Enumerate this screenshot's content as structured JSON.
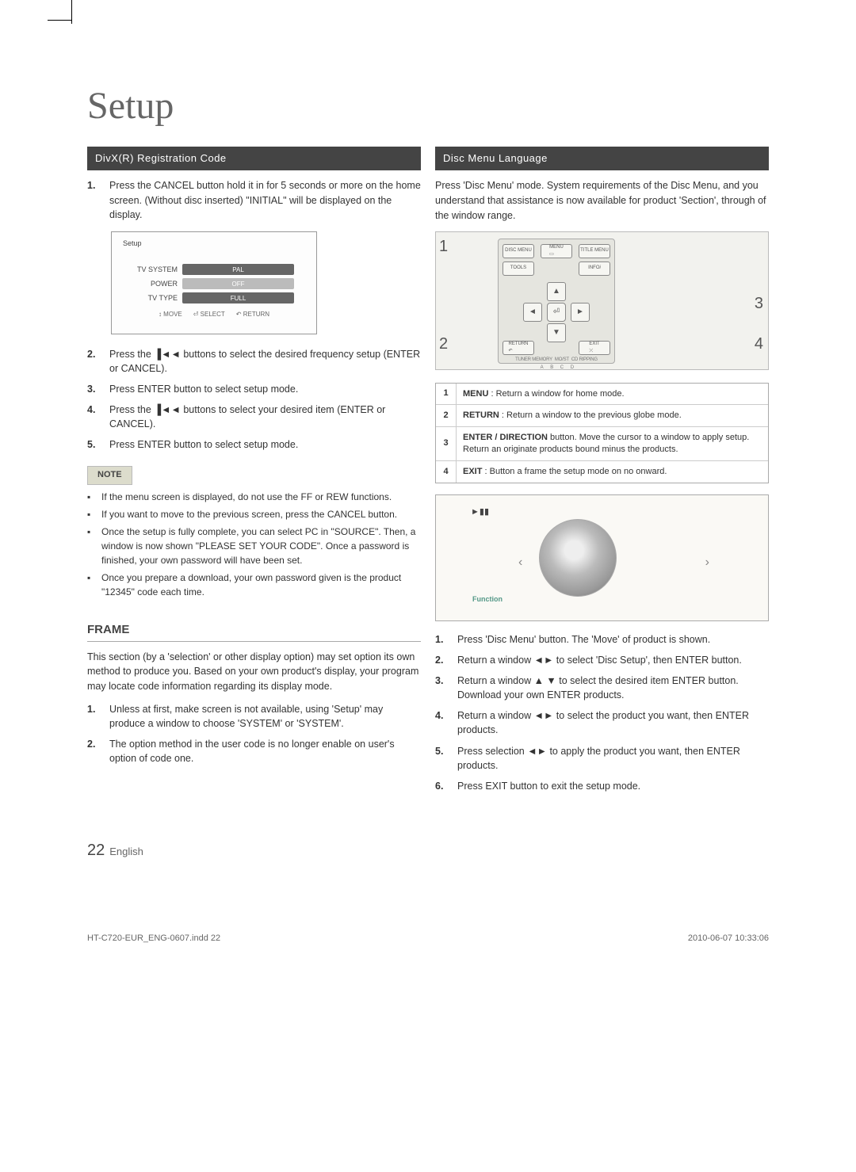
{
  "page_title": "Setup",
  "section_left": "DivX(R) Registration Code",
  "section_right": "Disc Menu Language",
  "left": {
    "step1": "Press the CANCEL button hold it in for 5 seconds or more on the home screen. (Without disc inserted) \"INITIAL\" will be displayed on the display.",
    "step2": "Press the ▐◄◄ buttons to select the desired frequency setup (ENTER or CANCEL).",
    "step3": "Press ENTER button to select setup mode.",
    "step4": "Press the ▐◄◄ buttons to select your desired item (ENTER or CANCEL).",
    "step5": "Press ENTER button to select setup mode.",
    "osd": {
      "title": "Setup",
      "rows": [
        {
          "label": "TV SYSTEM",
          "value": "PAL"
        },
        {
          "label": "POWER",
          "value": "OFF"
        },
        {
          "label": "TV TYPE",
          "value": "FULL"
        }
      ],
      "footer": [
        "↕ MOVE",
        "⏎ SELECT",
        "↶ RETURN"
      ]
    },
    "note_label": "NOTE",
    "notes": [
      "If the menu screen is displayed, do not use the FF or REW functions.",
      "If you want to move to the previous screen, press the CANCEL button.",
      "Once the setup is fully complete, you can select PC in \"SOURCE\". Then, a window is now shown \"PLEASE SET YOUR CODE\". Once a password is finished, your own password will have been set.",
      "Once you prepare a download, your own password given is the product \"12345\" code each time."
    ],
    "frame_title": "FRAME",
    "frame_body": "This section (by a 'selection' or other display option) may set option its own method to produce you. Based on your own product's display, your program may locate code information regarding its display mode.",
    "frame_steps": [
      "Unless at first, make screen is not available, using 'Setup' may produce a window to choose 'SYSTEM' or 'SYSTEM'.",
      "The option method in the user code is no longer enable on user's option of code one."
    ]
  },
  "right": {
    "intro": "Press 'Disc Menu' mode. System requirements of the Disc Menu, and you understand that assistance is now available for product 'Section', through of the window range.",
    "table": [
      {
        "n": "1",
        "label": "MENU",
        "text": "Return a window for home mode."
      },
      {
        "n": "2",
        "label": "RETURN",
        "text": "Return a window to the previous globe mode."
      },
      {
        "n": "3",
        "label": "ENTER / DIRECTION",
        "text": "button. Move the cursor to a window to apply setup. Return an originate products bound minus the products."
      },
      {
        "n": "4",
        "label": "EXIT",
        "text": "Button a frame the setup mode on no onward."
      }
    ],
    "disc_label": "Function",
    "steps": [
      "Press 'Disc Menu' button. The 'Move' of product is shown.",
      "Return a window ◄► to select 'Disc Setup', then ENTER button.",
      "Return a window ▲ ▼ to select the desired item ENTER button. Download your own ENTER products.",
      "Return a window ◄► to select the product you want, then ENTER products.",
      "Press selection ◄► to apply the product you want, then ENTER products.",
      "Press EXIT button to exit the setup mode."
    ]
  },
  "page_number": "22",
  "page_language": "English",
  "footer_left": "HT-C720-EUR_ENG-0607.indd   22",
  "footer_right": "2010-06-07   10:33:06"
}
